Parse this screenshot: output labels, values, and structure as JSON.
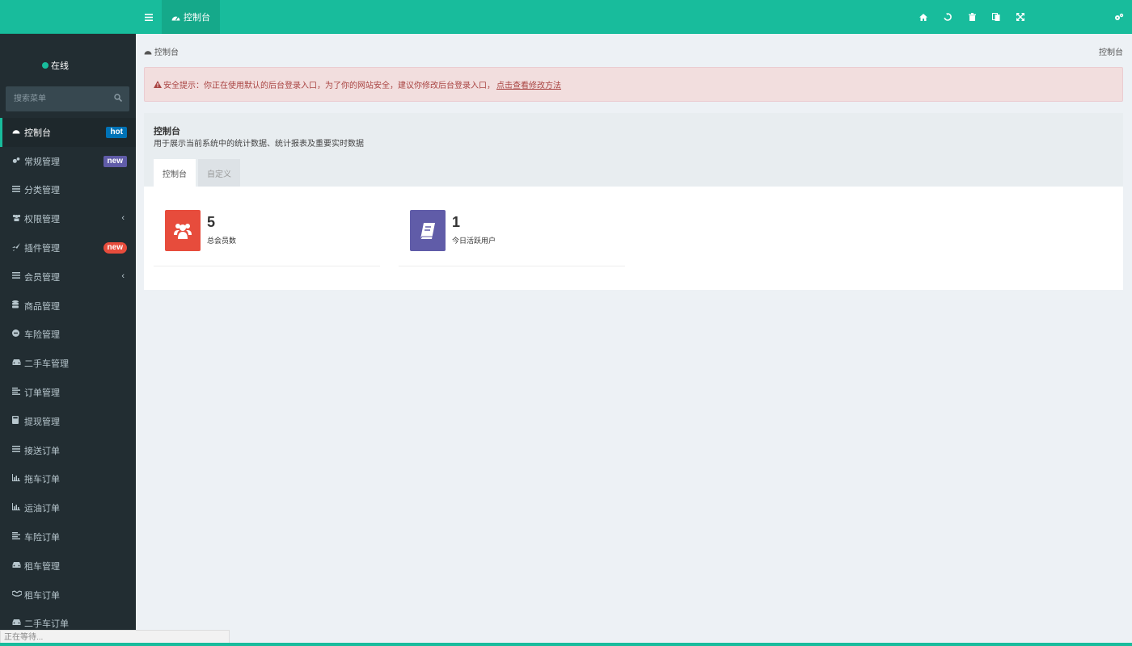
{
  "topbar": {
    "toggle_icon": "menu-icon",
    "tab_label": "控制台",
    "tab_icon": "dashboard-icon",
    "right_icons": [
      "home-icon",
      "refresh-icon",
      "trash-icon",
      "language-icon",
      "fullscreen-icon"
    ],
    "settings_icon": "cogs-icon",
    "brand_color": "#18bc9c"
  },
  "sidebar": {
    "status_text": "在线",
    "search_placeholder": "搜索菜单",
    "items": [
      {
        "label": "控制台",
        "icon": "dashboard-icon",
        "badge": "hot"
      },
      {
        "label": "常规管理",
        "icon": "cogs-icon",
        "badge": "new"
      },
      {
        "label": "分类管理",
        "icon": "list-icon"
      },
      {
        "label": "权限管理",
        "icon": "group-icon"
      },
      {
        "label": "插件管理",
        "icon": "rocket-icon",
        "badge": "new"
      },
      {
        "label": "会员管理",
        "icon": "list-icon"
      },
      {
        "label": "商品管理",
        "icon": "database-icon"
      },
      {
        "label": "车险管理",
        "icon": "minus-circle-icon"
      },
      {
        "label": "二手车管理",
        "icon": "car-icon"
      },
      {
        "label": "订单管理",
        "icon": "align-left-icon"
      },
      {
        "label": "提现管理",
        "icon": "calculator-icon"
      },
      {
        "label": "接送订单",
        "icon": "list-icon"
      },
      {
        "label": "拖车订单",
        "icon": "bar-chart-icon"
      },
      {
        "label": "运油订单",
        "icon": "bar-chart-icon"
      },
      {
        "label": "车险订单",
        "icon": "align-left-icon"
      },
      {
        "label": "租车管理",
        "icon": "car-icon"
      },
      {
        "label": "租车订单",
        "icon": "handshake-icon"
      },
      {
        "label": "二手车订单",
        "icon": "car-icon"
      }
    ]
  },
  "content": {
    "breadcrumb": "控制台",
    "breadcrumb_right": "控制台",
    "alert": {
      "text": "安全提示：你正在使用默认的后台登录入口，为了你的网站安全，建议你修改后台登录入口，",
      "link": "点击查看修改方法"
    },
    "panel": {
      "title": "控制台",
      "description": "用于展示当前系统中的统计数据、统计报表及重要实时数据",
      "tabs": [
        "控制台",
        "自定义"
      ]
    },
    "stats": [
      {
        "value": "5",
        "label": "总会员数",
        "icon": "users-icon",
        "color": "#e74c3c"
      },
      {
        "value": "1",
        "label": "今日活跃用户",
        "icon": "book-icon",
        "color": "#605ca8"
      }
    ]
  },
  "statusbar": "正在等待..."
}
